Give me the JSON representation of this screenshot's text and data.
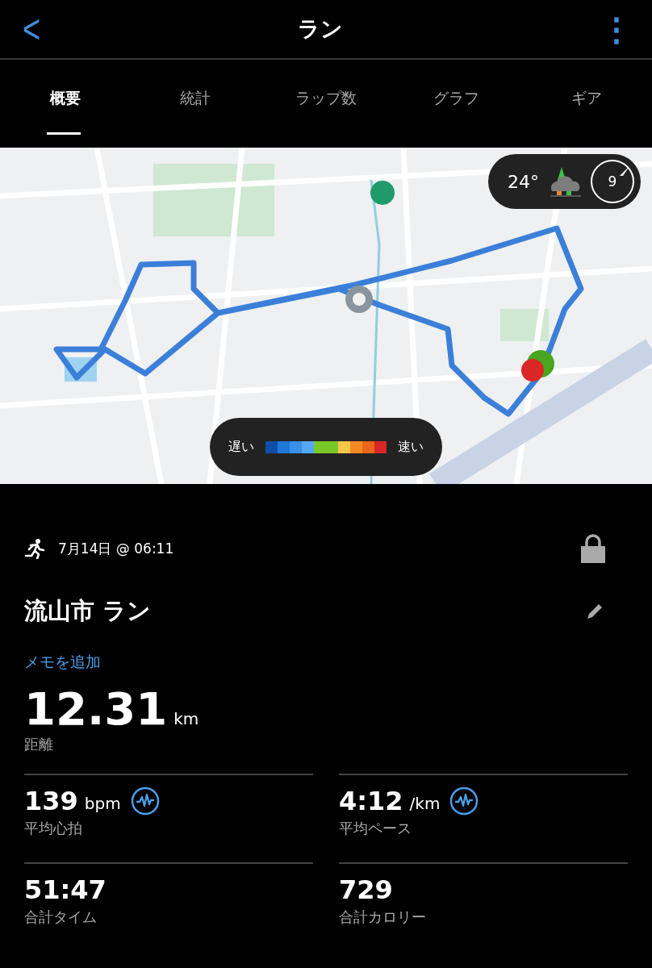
{
  "header": {
    "back": "<",
    "title": "ラン",
    "more": "⋮"
  },
  "tabs": [
    {
      "label": "概要",
      "selected": true
    },
    {
      "label": "統計",
      "selected": false
    },
    {
      "label": "ラップ数",
      "selected": false
    },
    {
      "label": "グラフ",
      "selected": false
    },
    {
      "label": "ギア",
      "selected": false
    }
  ],
  "map": {
    "kind": "picture",
    "weather": {
      "temperature": "24°",
      "wind": "9"
    },
    "legend": {
      "slow": "遅い",
      "fast": "速い",
      "colors": [
        {
          "color": "#0d4fa8"
        },
        {
          "color": "#1f78d8"
        },
        {
          "color": "#3a8fe8"
        },
        {
          "color": "#55a7f5"
        },
        {
          "color": "#7ac72a"
        },
        {
          "color": "#7ac72a"
        },
        {
          "color": "#f7c548"
        },
        {
          "color": "#f38a23"
        },
        {
          "color": "#e9661a"
        },
        {
          "color": "#d92626"
        }
      ]
    }
  },
  "activity": {
    "date": "7月14日 @ 06:11",
    "locked": true,
    "title": "流山市 ラン",
    "add_note": "メモを追加"
  },
  "distance": {
    "value": "12.31",
    "unit": "km",
    "label": "距離"
  },
  "stats": [
    {
      "value": "139",
      "unit": "bpm",
      "label": "平均心拍",
      "chart_link": true
    },
    {
      "value": "4:12",
      "unit": "/km",
      "label": "平均ペース",
      "chart_link": true
    },
    {
      "value": "51:47",
      "label": "合計タイム",
      "chart_link": false
    },
    {
      "value": "729",
      "label": "合計カロリー",
      "chart_link": false
    }
  ]
}
